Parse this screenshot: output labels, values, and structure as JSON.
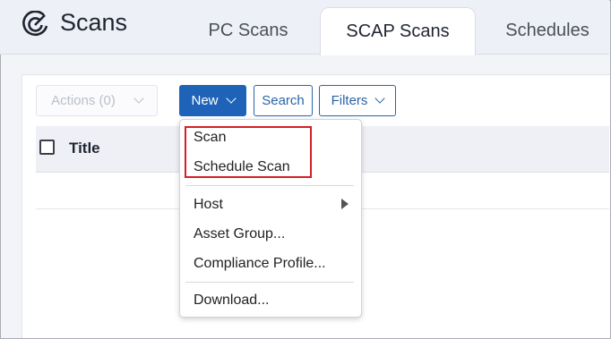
{
  "app": {
    "title": "Scans",
    "icon": "radar-icon"
  },
  "tabs": [
    {
      "label": "PC Scans"
    },
    {
      "label": "SCAP Scans",
      "active": true
    },
    {
      "label": "Schedules"
    }
  ],
  "toolbar": {
    "actions_label": "Actions (0)",
    "new_label": "New",
    "search_label": "Search",
    "filters_label": "Filters"
  },
  "table": {
    "columns": [
      "Title"
    ]
  },
  "new_menu": {
    "items": [
      {
        "label": "Scan"
      },
      {
        "label": "Schedule Scan"
      },
      {
        "label": "Host",
        "submenu": true
      },
      {
        "label": "Asset Group..."
      },
      {
        "label": "Compliance Profile..."
      },
      {
        "label": "Download..."
      }
    ]
  },
  "colors": {
    "primary": "#1f63b8",
    "highlight": "#d32027"
  }
}
